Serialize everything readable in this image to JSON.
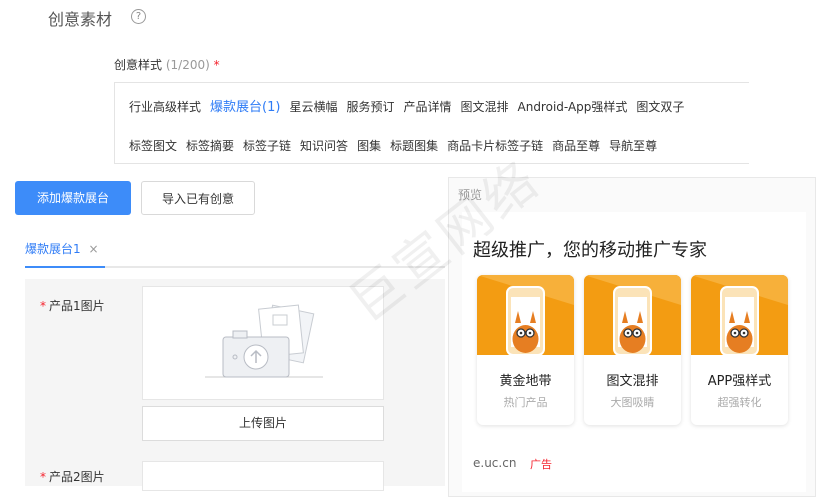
{
  "page": {
    "title": "创意素材",
    "help_icon": "?"
  },
  "style_selector": {
    "label": "创意样式",
    "count": "(1/200)",
    "required_mark": "*",
    "row1": [
      {
        "label": "行业高级样式",
        "active": false
      },
      {
        "label": "爆款展台(1)",
        "active": true
      },
      {
        "label": "星云横幅",
        "active": false
      },
      {
        "label": "服务预订",
        "active": false
      },
      {
        "label": "产品详情",
        "active": false
      },
      {
        "label": "图文混排",
        "active": false
      },
      {
        "label": "Android-App强样式",
        "active": false
      },
      {
        "label": "图文双子",
        "active": false
      }
    ],
    "row2": [
      {
        "label": "标签图文"
      },
      {
        "label": "标签摘要"
      },
      {
        "label": "标签子链"
      },
      {
        "label": "知识问答"
      },
      {
        "label": "图集"
      },
      {
        "label": "标题图集"
      },
      {
        "label": "商品卡片标签子链"
      },
      {
        "label": "商品至尊"
      },
      {
        "label": "导航至尊"
      }
    ]
  },
  "buttons": {
    "add": "添加爆款展台",
    "import": "导入已有创意"
  },
  "tabs": [
    {
      "label": "爆款展台1",
      "close": "×"
    }
  ],
  "form": {
    "required_mark": "*",
    "product1_label": "产品1图片",
    "product2_label": "产品2图片",
    "upload_label": "上传图片"
  },
  "preview": {
    "label": "预览",
    "headline": "超级推广，您的移动推广专家",
    "cards": [
      {
        "title": "黄金地带",
        "subtitle": "热门产品"
      },
      {
        "title": "图文混排",
        "subtitle": "大图吸睛"
      },
      {
        "title": "APP强样式",
        "subtitle": "超强转化"
      }
    ],
    "domain": "e.uc.cn",
    "ad_tag": "广告"
  },
  "watermark": "巨宣网络",
  "colors": {
    "accent": "#3d8cf9",
    "active_text": "#2f7cf6",
    "required": "#f5222d",
    "card_orange": "#f39c12"
  }
}
